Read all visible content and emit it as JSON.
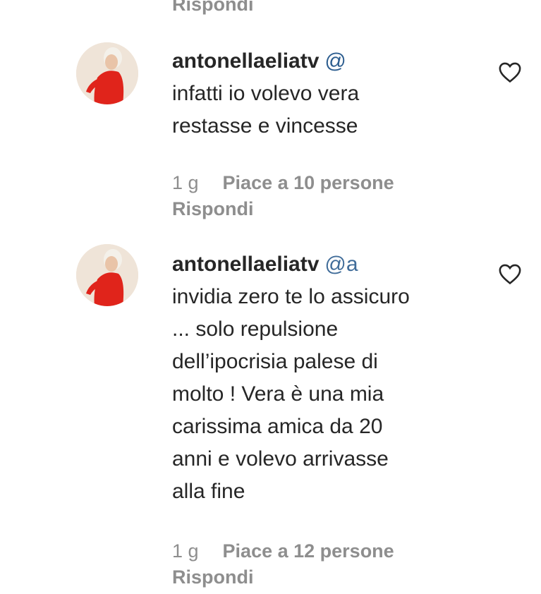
{
  "top_reply_label": "Rispondi",
  "comments": [
    {
      "username": "antonellaeliatv",
      "mention": "@",
      "text_lines": [
        "infatti io volevo vera",
        "restasse e vincesse"
      ],
      "time": "1 g",
      "likes": "Piace a 10 persone",
      "reply_label": "Rispondi"
    },
    {
      "username": "antonellaeliatv",
      "mention": "@a",
      "text_lines": [
        "invidia zero te lo assicuro",
        "... solo repulsione",
        "dell’ipocrisia palese di",
        "molto ! Vera è una mia",
        "carissima amica da 20",
        "anni e volevo arrivasse",
        "alla fine"
      ],
      "time": "1 g",
      "likes": "Piace a 12 persone",
      "reply_label": "Rispondi"
    }
  ],
  "icons": {
    "like": "heart-outline-icon",
    "avatar": "profile-photo-woman-red-dress"
  },
  "colors": {
    "text": "#262626",
    "secondary": "#8e8e8e",
    "mention": "#2c5d8f",
    "avatar_dress": "#e0241b"
  }
}
